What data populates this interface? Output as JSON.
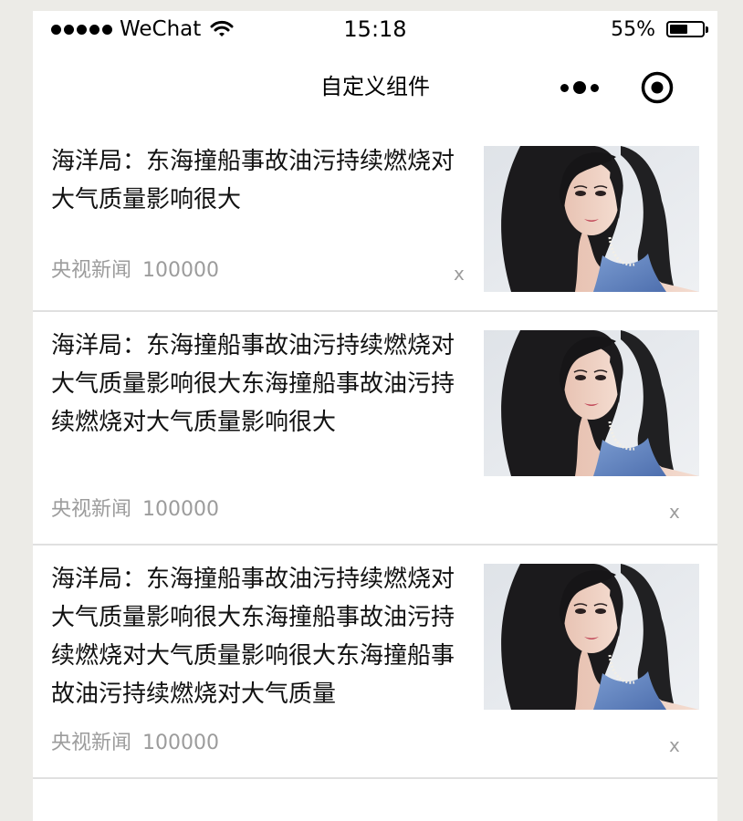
{
  "status_bar": {
    "carrier": "WeChat",
    "time": "15:18",
    "battery_percent": "55%",
    "battery_level": 0.55,
    "signal_icon": "signal-dots-icon",
    "wifi_icon": "wifi-icon"
  },
  "nav": {
    "title": "自定义组件",
    "more_icon": "more-dots-icon",
    "close_icon": "target-circle-icon"
  },
  "news": [
    {
      "title": "海洋局：东海撞船事故油污持续燃烧对大气质量影响很大",
      "source": "央视新闻",
      "count": "100000",
      "close": "x"
    },
    {
      "title": "海洋局：东海撞船事故油污持续燃烧对大气质量影响很大东海撞船事故油污持续燃烧对大气质量影响很大",
      "source": "央视新闻",
      "count": "100000",
      "close": "x"
    },
    {
      "title": "海洋局：东海撞船事故油污持续燃烧对大气质量影响很大东海撞船事故油污持续燃烧对大气质量影响很大东海撞船事故油污持续燃烧对大气质量",
      "source": "央视新闻",
      "count": "100000",
      "close": "x"
    }
  ]
}
